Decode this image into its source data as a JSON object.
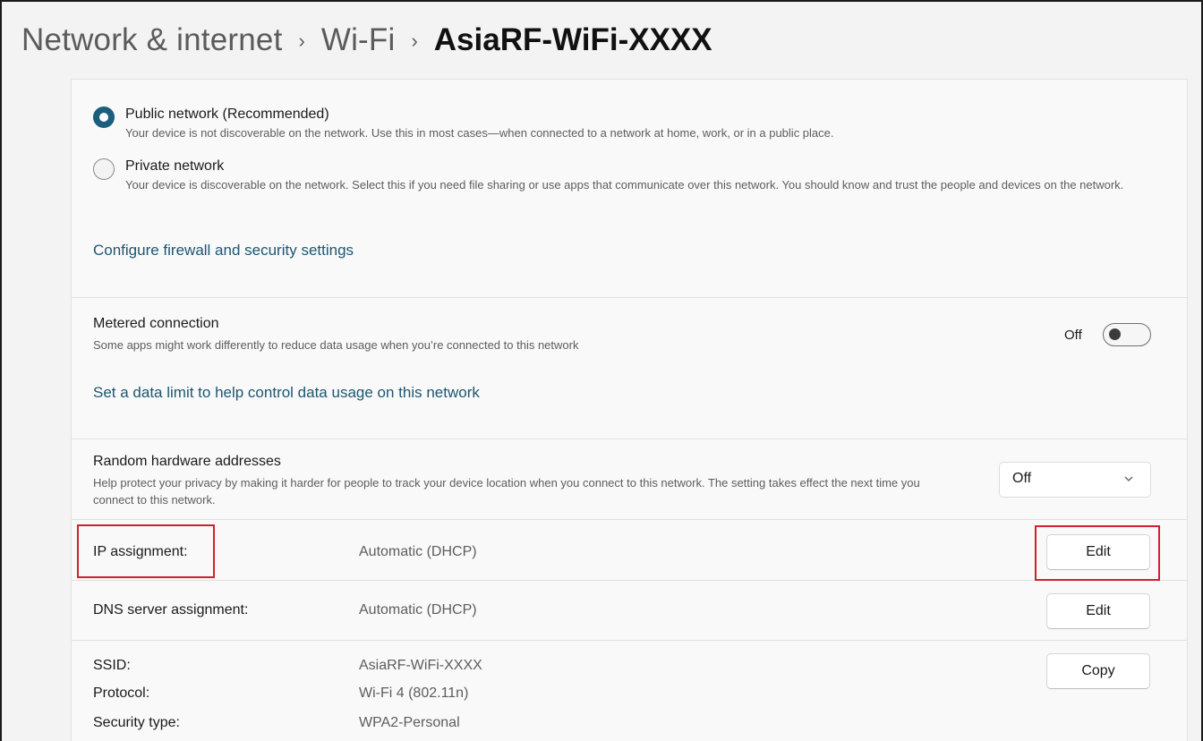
{
  "breadcrumb": {
    "items": [
      "Network & internet",
      "Wi-Fi"
    ],
    "separator": "›",
    "current": "AsiaRF-WiFi-XXXX"
  },
  "network_profile": {
    "options": [
      {
        "title": "Public network (Recommended)",
        "description": "Your device is not discoverable on the network. Use this in most cases—when connected to a network at home, work, or in a public place.",
        "selected": true
      },
      {
        "title": "Private network",
        "description": "Your device is discoverable on the network. Select this if you need file sharing or use apps that communicate over this network. You should know and trust the people and devices on the network.",
        "selected": false
      }
    ],
    "firewall_link": "Configure firewall and security settings"
  },
  "metered": {
    "title": "Metered connection",
    "description": "Some apps might work differently to reduce data usage when you’re connected to this network",
    "toggle_label": "Off",
    "toggle_on": false,
    "data_limit_link": "Set a data limit to help control data usage on this network"
  },
  "random_hw": {
    "title": "Random hardware addresses",
    "description": "Help protect your privacy by making it harder for people to track your device location when you connect to this network. The setting takes effect the next time you connect to this network.",
    "dropdown_value": "Off"
  },
  "ip": {
    "label": "IP assignment:",
    "value": "Automatic (DHCP)",
    "button": "Edit"
  },
  "dns": {
    "label": "DNS server assignment:",
    "value": "Automatic (DHCP)",
    "button": "Edit"
  },
  "properties": {
    "rows": [
      {
        "label": "SSID:",
        "value": "AsiaRF-WiFi-XXXX"
      },
      {
        "label": "Protocol:",
        "value": "Wi-Fi 4 (802.11n)"
      },
      {
        "label": "Security type:",
        "value": "WPA2-Personal"
      }
    ],
    "copy_button": "Copy"
  },
  "colors": {
    "accent": "#1b5e7d",
    "link": "#1d5670",
    "highlight": "#d1202f"
  }
}
